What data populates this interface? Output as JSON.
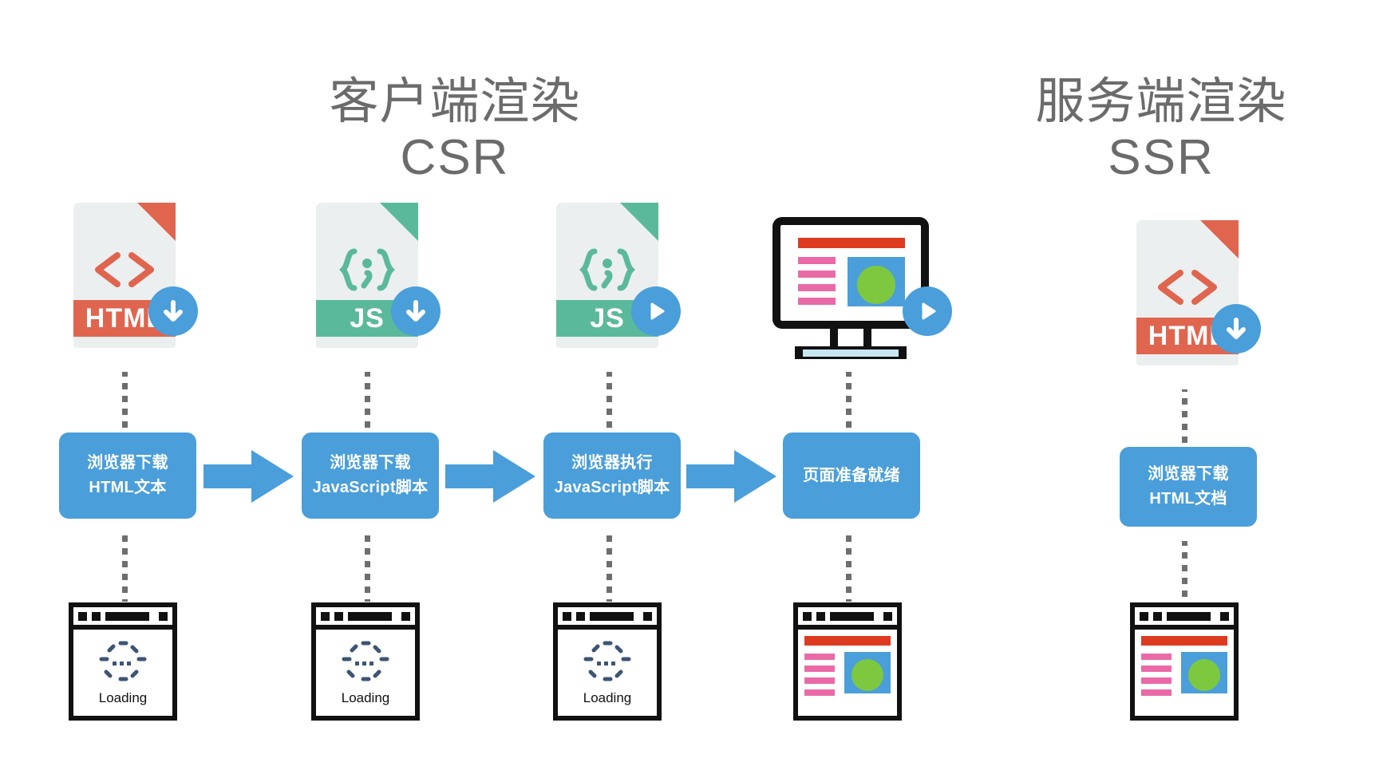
{
  "titles": {
    "csr": "客户端渲染\nCSR",
    "csr_cn": "客户端渲染",
    "csr_abbr": "CSR",
    "ssr": "服务端渲染\nSSR",
    "ssr_cn": "服务端渲染",
    "ssr_abbr": "SSR"
  },
  "colors": {
    "accent_blue": "#4a9eda",
    "html_red": "#e0654f",
    "js_green": "#5bb99b",
    "title_gray": "#6b6b6b",
    "page_red": "#dd3b20",
    "page_pink": "#e96aa6",
    "page_green": "#7ec840",
    "dot_gray": "#6e6e6e"
  },
  "csr_flow": {
    "assets": [
      {
        "kind": "file",
        "label": "HTML",
        "glyph": "code-angle-brackets",
        "color": "#e0654f",
        "badge": "download-icon"
      },
      {
        "kind": "file",
        "label": "JS",
        "glyph": "curly-braces-semicolon",
        "color": "#5bb99b",
        "badge": "download-icon"
      },
      {
        "kind": "file",
        "label": "JS",
        "glyph": "curly-braces-semicolon",
        "color": "#5bb99b",
        "badge": "play-icon"
      },
      {
        "kind": "monitor",
        "label": "",
        "glyph": "rendered-page",
        "color": "#111111",
        "badge": "play-icon"
      }
    ],
    "steps": [
      "浏览器下载\nHTML文本",
      "浏览器下载\nJavaScript脚本",
      "浏览器执行\nJavaScript脚本",
      "页面准备就绪"
    ],
    "results": [
      {
        "state": "loading",
        "label": "Loading"
      },
      {
        "state": "loading",
        "label": "Loading"
      },
      {
        "state": "loading",
        "label": "Loading"
      },
      {
        "state": "ready",
        "label": ""
      }
    ],
    "arrows": 3
  },
  "ssr_flow": {
    "assets": [
      {
        "kind": "file",
        "label": "HTML",
        "glyph": "code-angle-brackets",
        "color": "#e0654f",
        "badge": "download-icon"
      }
    ],
    "steps": [
      "浏览器下载\nHTML文档"
    ],
    "results": [
      {
        "state": "ready",
        "label": ""
      }
    ]
  }
}
